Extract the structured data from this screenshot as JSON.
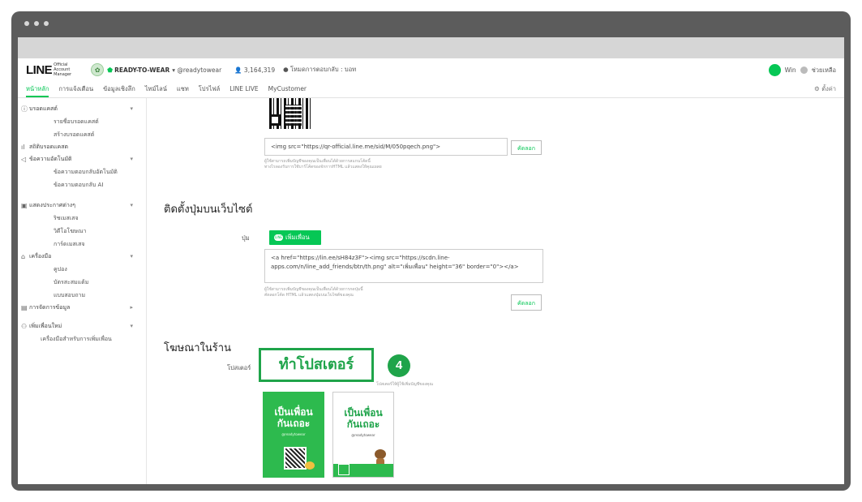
{
  "header": {
    "logo": "LINE",
    "logo_sub": "Official Account Manager",
    "account_name": "READY-TO-WEAR",
    "account_id": "@readytowear",
    "friends_count": "3,164,319",
    "plan": "โหมดการตอบกลับ : บอท",
    "user": "Win",
    "help": "ช่วยเหลือ"
  },
  "nav": {
    "items": [
      "หน้าหลัก",
      "การแจ้งเตือน",
      "ข้อมูลเชิงลึก",
      "ไทม์ไลน์",
      "แชท",
      "โปรไฟล์",
      "LINE LIVE",
      "MyCustomer"
    ],
    "settings": "⚙ ตั้งค่า"
  },
  "sidebar": {
    "groups": [
      {
        "icon": "ⓘ",
        "label": "บรอดแคสต์",
        "chevron": "▾",
        "items": [
          "รายชื่อบรอดแคสต์",
          "สร้างบรอดแคสต์"
        ]
      },
      {
        "icon": "ıl",
        "label": "สถิติบรอดแคสต",
        "chevron": "",
        "items": []
      },
      {
        "icon": "◁",
        "label": "ข้อความอัตโนมัติ",
        "chevron": "▾",
        "items": [
          "ข้อความตอบกลับอัตโนมัติ",
          "ข้อความตอบกลับ AI"
        ]
      },
      {
        "icon": "▣",
        "label": "แสดงประกาศต่างๆ",
        "chevron": "▾",
        "items": [
          "ริชเมสเสจ",
          "วิดีโอโฆษณา",
          "การ์ดเมสเสจ"
        ]
      },
      {
        "icon": "⌂",
        "label": "เครื่องมือ",
        "chevron": "▾",
        "items": [
          "คูปอง",
          "บัตรสะสมแต้ม",
          "แบบสอบถาม"
        ]
      },
      {
        "icon": "▤",
        "label": "การจัดการข้อมูล",
        "chevron": "▸",
        "items": []
      },
      {
        "icon": "⚇",
        "label": "เพิ่มเพื่อนใหม่",
        "chevron": "▾",
        "items": [
          "เครื่องมือสำหรับการเพิ่มเพื่อน"
        ]
      }
    ]
  },
  "main": {
    "qr_code": "<img src=\"https://qr-official.line.me/sid/M/050pqech.png\">",
    "copy_label": "คัดลอก",
    "qr_hint_line1": "ผู้ใช้สามารถเพิ่มบัญชีของคุณเป็นเพื่อนได้ด้วยการสแกนโค้ดนี้",
    "qr_hint_line2": "ทางไรลองรับการใช้บาร์โค้ดของจักการHTML แล้วแสดงให้คุณเผลย",
    "button_section_title": "ติดตั้งปุ่มบนเว็บไซต์",
    "button_label": "ปุ่ม",
    "add_friend_button": "เพิ่มเพื่อน",
    "button_code": "<a href=\"https://lin.ee/sH84z3F\"><img src=\"https://scdn.line-apps.com/n/line_add_friends/btn/th.png\" alt=\"เพิ่มเพื่อน\" height=\"36\" border=\"0\"></a>",
    "button_hint_line1": "ผู้ใช้สามารถเพิ่มบัญชีของคุณเป็นเพื่อนได้ด้วยการกดปุ่มนี้",
    "button_hint_line2": "คัดลอกโค้ด HTML แล้วแสดงปุ่มบนเว็บไซต์ของคุณ",
    "ads_section_title": "โฆษณาในร้าน",
    "poster_label": "โปสเตอร์",
    "make_poster_button": "ทำโปสเตอร์",
    "step_number": "4",
    "poster_hint": "โปสเตอร์ให้ผู้ใช้เพิ่มบัญชีของคุณ",
    "poster_title_1": "เป็นเพื่อน",
    "poster_title_2": "กันเถอะ",
    "poster_sub": "@readytowear"
  },
  "colors": {
    "line_green": "#06c755",
    "highlight_green": "#1fa44a"
  }
}
